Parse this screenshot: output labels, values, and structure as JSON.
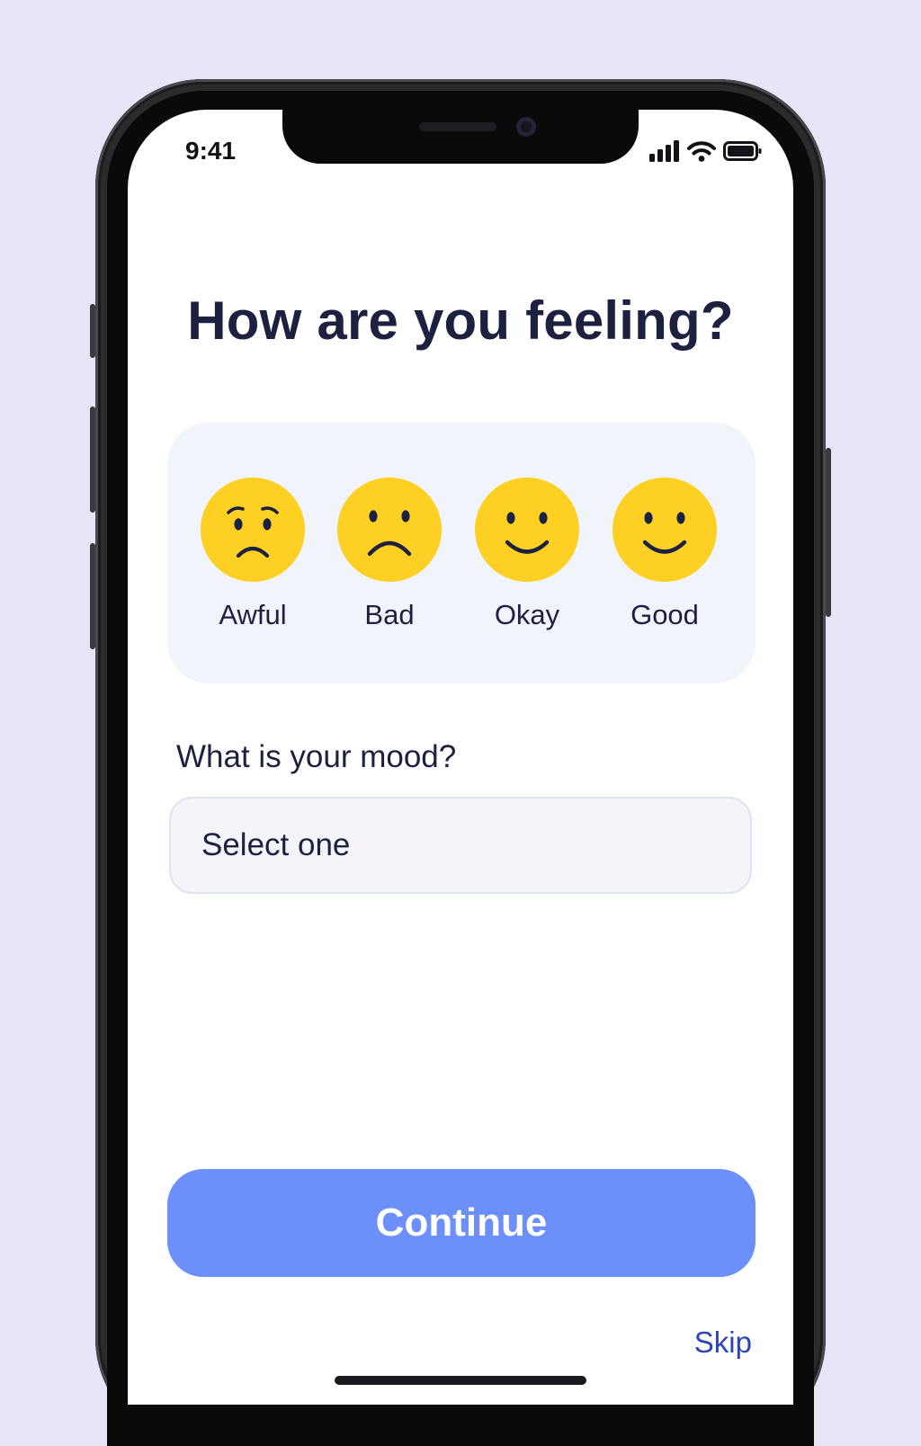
{
  "status_bar": {
    "time": "9:41",
    "icons": [
      "cellular-signal-icon",
      "wifi-icon",
      "battery-icon"
    ]
  },
  "screen": {
    "title": "How are you feeling?"
  },
  "mood_options": [
    {
      "label": "Awful",
      "icon": "worried-face-icon"
    },
    {
      "label": "Bad",
      "icon": "frowning-face-icon"
    },
    {
      "label": "Okay",
      "icon": "smiling-face-icon"
    },
    {
      "label": "Good",
      "icon": "smiling-face-icon"
    }
  ],
  "mood_field": {
    "label": "What is your mood?",
    "value": "Select one"
  },
  "actions": {
    "continue_label": "Continue",
    "skip_label": "Skip"
  },
  "colors": {
    "background": "#e9e5f8",
    "face": "#fdd023",
    "text": "#1d2140",
    "primary_button": "#6c8ffa",
    "link": "#2c44b8",
    "card": "#f1f4fb"
  }
}
